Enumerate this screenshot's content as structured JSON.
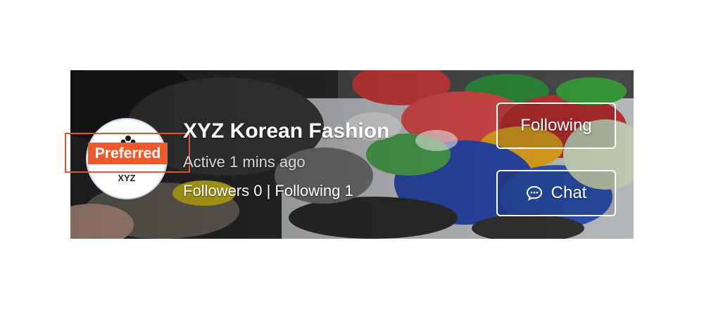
{
  "shop": {
    "name": "XYZ Korean Fashion",
    "active_status": "Active 1 mins ago",
    "stats": "Followers 0 | Following 1",
    "avatar_text": "XYZ",
    "badge": "Preferred"
  },
  "actions": {
    "following_label": "Following",
    "chat_label": "Chat"
  },
  "icons": {
    "chat": "chat-bubble-icon",
    "logo": "paw-logo-icon"
  },
  "colors": {
    "badge": "#ef5a2c",
    "badge_outline": "#e2532e"
  }
}
